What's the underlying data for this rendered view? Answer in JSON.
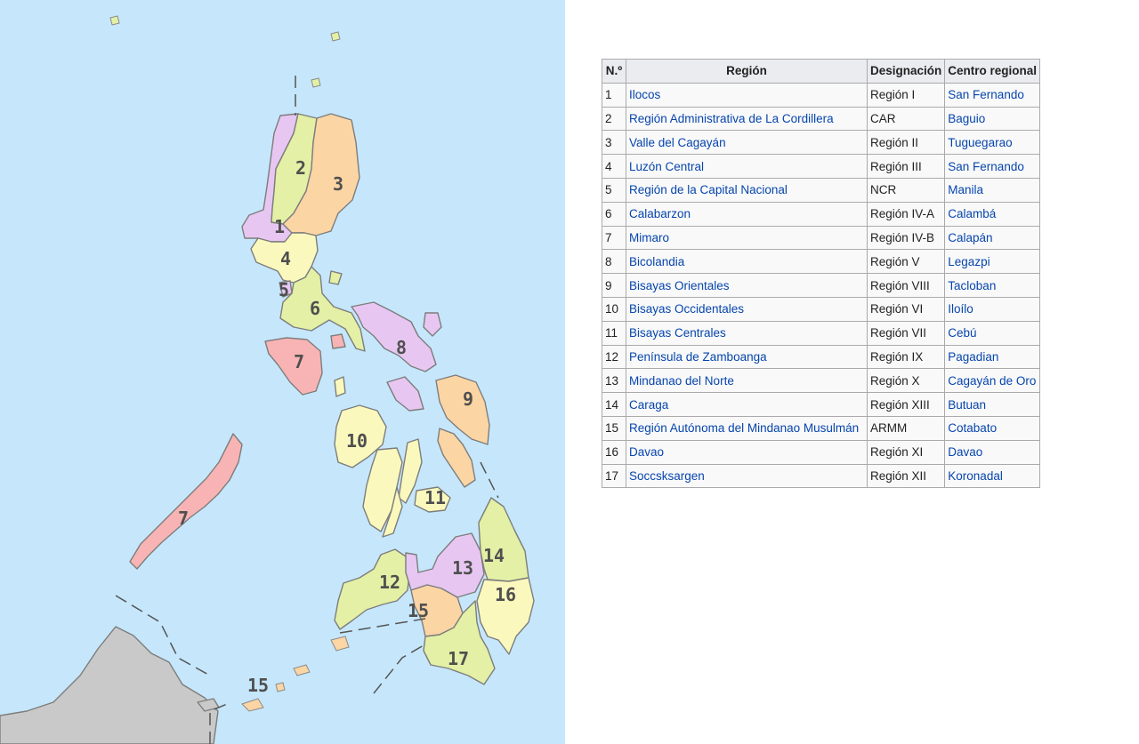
{
  "map": {
    "colors": {
      "sea": "#c6e7fb",
      "green": "#e3f0a5",
      "yellow": "#fbf8bd",
      "orange": "#fcd5a4",
      "violet": "#e7c7f1",
      "pink": "#f8b4b4",
      "gray": "#c9c9c9"
    },
    "labels": [
      {
        "id": "r1",
        "text": "1"
      },
      {
        "id": "r2",
        "text": "2"
      },
      {
        "id": "r3",
        "text": "3"
      },
      {
        "id": "r4",
        "text": "4"
      },
      {
        "id": "r5",
        "text": "5"
      },
      {
        "id": "r6",
        "text": "6"
      },
      {
        "id": "r7a",
        "text": "7"
      },
      {
        "id": "r7b",
        "text": "7"
      },
      {
        "id": "r8",
        "text": "8"
      },
      {
        "id": "r9",
        "text": "9"
      },
      {
        "id": "r10",
        "text": "10"
      },
      {
        "id": "r11",
        "text": "11"
      },
      {
        "id": "r12",
        "text": "12"
      },
      {
        "id": "r13",
        "text": "13"
      },
      {
        "id": "r14",
        "text": "14"
      },
      {
        "id": "r15a",
        "text": "15"
      },
      {
        "id": "r15b",
        "text": "15"
      },
      {
        "id": "r16",
        "text": "16"
      },
      {
        "id": "r17",
        "text": "17"
      }
    ]
  },
  "table": {
    "headers": {
      "num": "N.º",
      "region": "Región",
      "designation": "Designación",
      "center": "Centro regional"
    },
    "link_color": "#0645ad",
    "rows": [
      {
        "num": "1",
        "region": "Ilocos",
        "designation": "Región I",
        "center": "San Fernando"
      },
      {
        "num": "2",
        "region": "Región Administrativa de La Cordillera",
        "designation": "CAR",
        "center": "Baguio"
      },
      {
        "num": "3",
        "region": "Valle del Cagayán",
        "designation": "Región II",
        "center": "Tuguegarao"
      },
      {
        "num": "4",
        "region": "Luzón Central",
        "designation": "Región III",
        "center": "San Fernando"
      },
      {
        "num": "5",
        "region": "Región de la Capital Nacional",
        "designation": "NCR",
        "center": "Manila"
      },
      {
        "num": "6",
        "region": "Calabarzon",
        "designation": "Región IV-A",
        "center": "Calambá"
      },
      {
        "num": "7",
        "region": "Mimaro",
        "designation": "Región IV-B",
        "center": "Calapán"
      },
      {
        "num": "8",
        "region": "Bicolandia",
        "designation": "Región V",
        "center": "Legazpi"
      },
      {
        "num": "9",
        "region": "Bisayas Orientales",
        "designation": "Región VIII",
        "center": "Tacloban"
      },
      {
        "num": "10",
        "region": "Bisayas Occidentales",
        "designation": "Región VI",
        "center": "Iloílo"
      },
      {
        "num": "11",
        "region": "Bisayas Centrales",
        "designation": "Región VII",
        "center": "Cebú"
      },
      {
        "num": "12",
        "region": "Península de Zamboanga",
        "designation": "Región IX",
        "center": "Pagadian"
      },
      {
        "num": "13",
        "region": "Mindanao del Norte",
        "designation": "Región X",
        "center": "Cagayán de Oro"
      },
      {
        "num": "14",
        "region": "Caraga",
        "designation": "Región XIII",
        "center": "Butuan"
      },
      {
        "num": "15",
        "region": "Región Autónoma del Mindanao Musulmán",
        "designation": "ARMM",
        "center": "Cotabato"
      },
      {
        "num": "16",
        "region": "Davao",
        "designation": "Región XI",
        "center": "Davao"
      },
      {
        "num": "17",
        "region": "Soccsksargen",
        "designation": "Región XII",
        "center": "Koronadal"
      }
    ]
  }
}
